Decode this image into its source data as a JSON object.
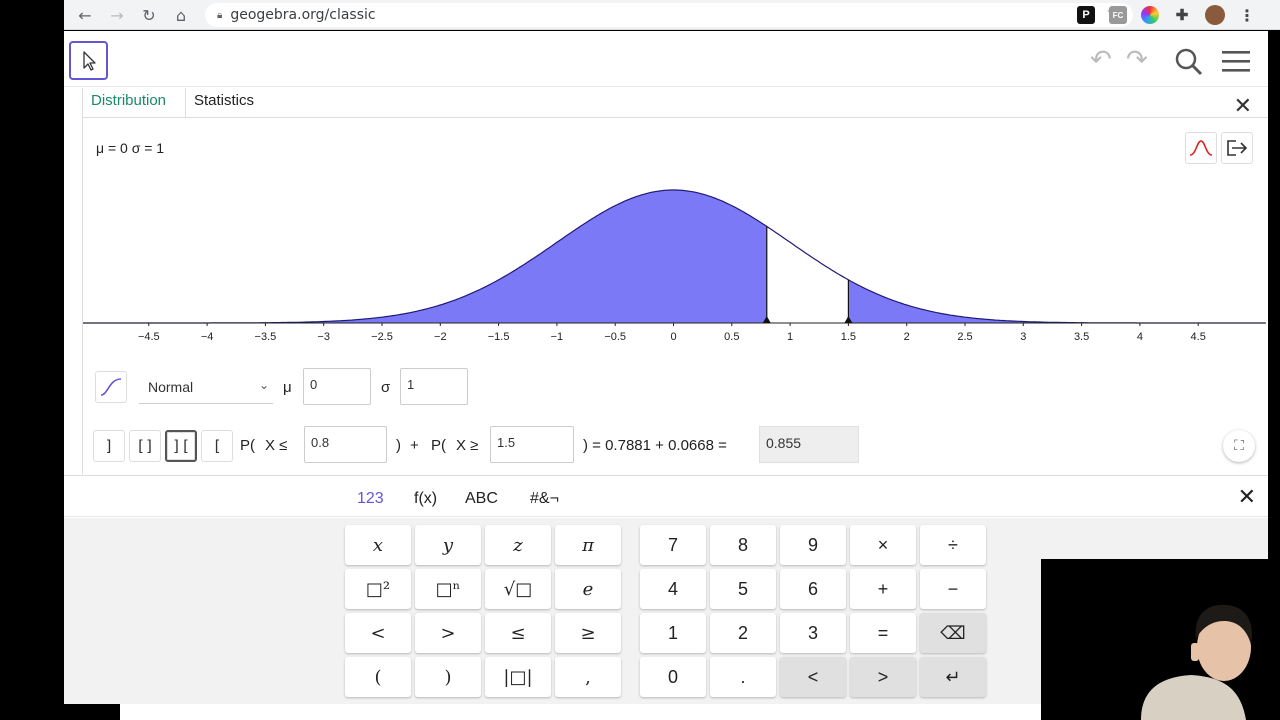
{
  "browser": {
    "url": "geogebra.org/classic",
    "extensions": [
      "P",
      "FC"
    ]
  },
  "calculator": {
    "tabs": [
      "Distribution",
      "Statistics"
    ],
    "params_label": "μ = 0 σ = 1",
    "distribution": "Normal",
    "mu_label": "μ",
    "mu_value": "0",
    "sigma_label": "σ",
    "sigma_value": "1",
    "prob_open_1": "P(",
    "x_le": "X ≤",
    "lower_value": "0.8",
    "close_1": ")",
    "plus": "+",
    "prob_open_2": "P(",
    "x_ge": "X ≥",
    "upper_value": "1.5",
    "sum_text": ") = 0.7881 + 0.0668 =",
    "result": "0.855"
  },
  "chart_data": {
    "type": "area",
    "mu": 0,
    "sigma": 1,
    "xlim": [
      -5,
      5
    ],
    "ticks": [
      "-4.5",
      "-4",
      "-3.5",
      "-3",
      "-2.5",
      "-2",
      "-1.5",
      "-1",
      "-0.5",
      "0",
      "0.5",
      "1",
      "1.5",
      "2",
      "2.5",
      "3",
      "3.5",
      "4",
      "4.5"
    ],
    "shaded_regions": [
      [
        -5,
        0.8
      ],
      [
        1.5,
        5
      ]
    ],
    "marker_points": [
      0.8,
      1.5
    ],
    "fill_color": "#7c79f6",
    "line_color": "#1f1a78"
  },
  "keyboard": {
    "tabs": [
      "123",
      "f(x)",
      "ABC",
      "#&¬"
    ],
    "left_keys": [
      [
        "x",
        "y",
        "z",
        "π"
      ],
      [
        "□²",
        "□ⁿ",
        "√□",
        "e"
      ],
      [
        "<",
        ">",
        "≤",
        "≥"
      ],
      [
        "(",
        ")",
        "|□|",
        ","
      ]
    ],
    "right_keys": [
      [
        "7",
        "8",
        "9",
        "×",
        "÷"
      ],
      [
        "4",
        "5",
        "6",
        "+",
        "−"
      ],
      [
        "1",
        "2",
        "3",
        "=",
        "⌫"
      ],
      [
        "0",
        ".",
        "<",
        ">",
        "↵"
      ]
    ]
  },
  "colors": {
    "accent": "#6557d2",
    "tab_active": "#1b8a6b"
  }
}
